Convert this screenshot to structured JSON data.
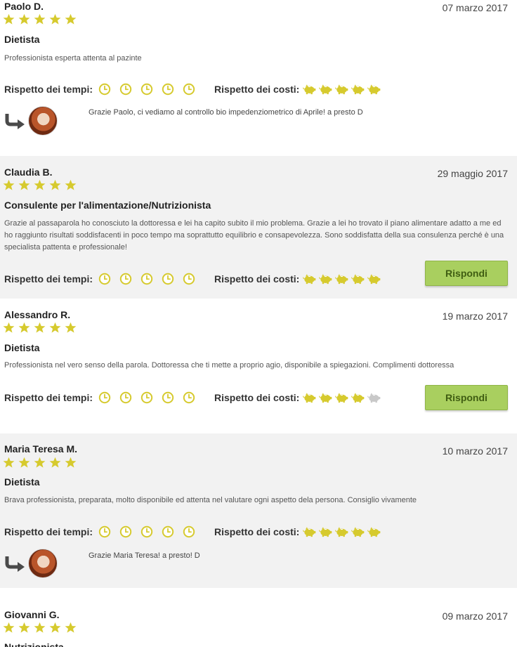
{
  "colors": {
    "star": "#d6ca2e",
    "clock": "#d6ca2e",
    "pig_on": "#d6ca2e",
    "pig_off": "#c8c8c8",
    "button": "#a9cf5f"
  },
  "labels": {
    "tempi": "Rispetto dei tempi:",
    "costi": "Rispetto dei costi:",
    "reply_button": "Rispondi"
  },
  "reviews": [
    {
      "name": "Paolo D.",
      "date": "07 marzo 2017",
      "stars": 5,
      "role": "Dietista",
      "text": "Professionista esperta attenta al pazinte",
      "tempi": 5,
      "costi": 5,
      "reply": "Grazie Paolo, ci vediamo al controllo bio impedenziometrico di Aprile! a presto D"
    },
    {
      "name": "Claudia B.",
      "date": "29 maggio 2017",
      "stars": 5,
      "role": "Consulente per l'alimentazione/Nutrizionista",
      "text": "Grazie al passaparola ho conosciuto la dottoressa e lei ha capito subito il mio problema. Grazie a lei ho trovato il piano alimentare adatto a me ed ho raggiunto risultati soddisfacenti in poco tempo ma soprattutto equilibrio e consapevolezza. Sono soddisfatta della sua consulenza perché è una specialista pattenta e professionale!",
      "tempi": 5,
      "costi": 5
    },
    {
      "name": "Alessandro R.",
      "date": "19 marzo 2017",
      "stars": 5,
      "role": "Dietista",
      "text": "Professionista nel vero senso della parola. Dottoressa che ti mette a proprio agio, disponibile a spiegazioni. Complimenti dottoressa",
      "tempi": 5,
      "costi": 4
    },
    {
      "name": "Maria Teresa M.",
      "date": "10 marzo 2017",
      "stars": 5,
      "role": "Dietista",
      "text": "Brava professionista, preparata, molto disponibile ed attenta nel valutare ogni aspetto dela persona. Consiglio vivamente",
      "tempi": 5,
      "costi": 5,
      "reply": "Grazie Maria Teresa! a presto! D"
    },
    {
      "name": "Giovanni G.",
      "date": "09 marzo 2017",
      "stars": 5,
      "role": "Nutrizionista"
    }
  ]
}
